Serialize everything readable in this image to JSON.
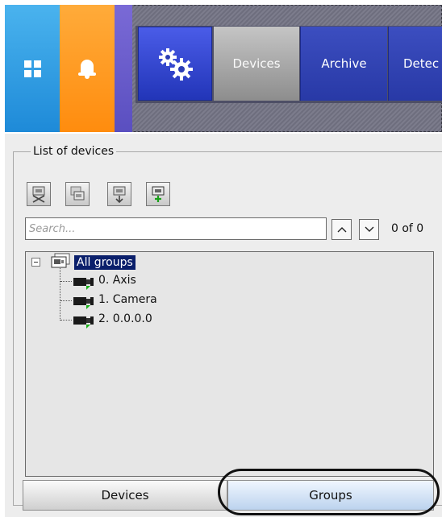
{
  "top_nav": {
    "tiles": [
      {
        "name": "windows-icon",
        "color": "#2a96e2"
      },
      {
        "name": "bell-icon",
        "color": "#ff9a1e"
      }
    ],
    "settings_icon": "gears-icon",
    "tabs": [
      {
        "label": "Devices",
        "active": true
      },
      {
        "label": "Archive",
        "active": false
      },
      {
        "label": "Detec",
        "active": false
      }
    ],
    "colors": {
      "accent": "#2a3cb4",
      "active_tab": "#a8a8a8"
    }
  },
  "panel": {
    "group_title": "List of devices",
    "toolbar_buttons": [
      "remove-camera-icon",
      "copy-camera-icon",
      "move-camera-icon",
      "add-camera-icon"
    ],
    "search": {
      "placeholder": "Search...",
      "value": ""
    },
    "nav_up_icon": "chevron-up-icon",
    "nav_down_icon": "chevron-down-icon",
    "result_counter": "0 of 0",
    "tree": {
      "root": {
        "label": "All groups",
        "expanded": true,
        "selected": true
      },
      "items": [
        "0. Axis",
        "1. Camera",
        "2. 0.0.0.0"
      ]
    },
    "bottom_tabs": [
      {
        "label": "Devices",
        "active": false
      },
      {
        "label": "Groups",
        "active": true
      }
    ]
  }
}
